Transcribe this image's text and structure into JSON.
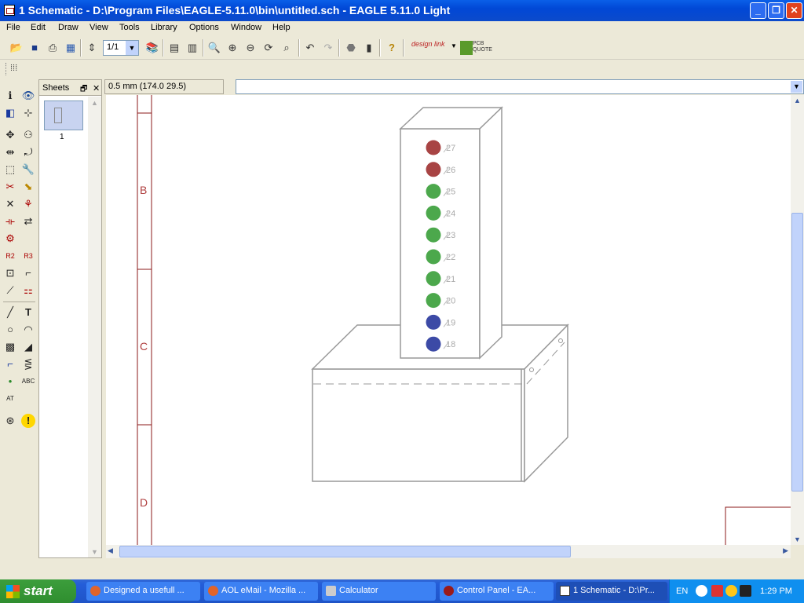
{
  "window": {
    "title": "1 Schematic - D:\\Program Files\\EAGLE-5.11.0\\bin\\untitled.sch - EAGLE 5.11.0 Light",
    "btn_min": "_",
    "btn_max": "❐",
    "btn_close": "✕"
  },
  "menu": [
    "File",
    "Edit",
    "Draw",
    "View",
    "Tools",
    "Library",
    "Options",
    "Window",
    "Help"
  ],
  "toolbar": {
    "sheet_select_value": "1/1",
    "design_link_label": "design link",
    "pcb_quote_label": "PCB QUOTE"
  },
  "sheets_panel": {
    "title": "Sheets",
    "float_icon": "🗗",
    "close_icon": "✕",
    "sheet_number": "1"
  },
  "coordinate_display": "0.5 mm (174.0 29.5)",
  "command_input": "",
  "frame": {
    "row_labels": [
      "B",
      "C",
      "D"
    ]
  },
  "led_labels": [
    "27",
    "26",
    "25",
    "24",
    "23",
    "22",
    "21",
    "20",
    "19",
    "18"
  ],
  "led_colors": [
    "#A84444",
    "#A84444",
    "#4CA84C",
    "#4CA84C",
    "#4CA84C",
    "#4CA84C",
    "#4CA84C",
    "#4CA84C",
    "#3C4AA6",
    "#3C4AA6"
  ],
  "taskbar": {
    "start_label": "start",
    "tasks": [
      "Designed a usefull ...",
      "AOL eMail - Mozilla ...",
      "Calculator",
      "Control Panel - EA...",
      "1 Schematic - D:\\Pr..."
    ],
    "language": "EN",
    "clock": "1:29 PM"
  },
  "colors": {
    "titlebar_blue": "#0A5FE8",
    "frame_red": "#8B1A1A",
    "drawing_gray": "#999999"
  }
}
